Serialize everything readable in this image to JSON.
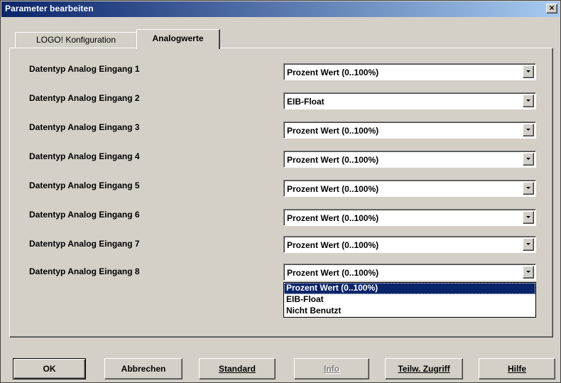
{
  "window": {
    "title": "Parameter bearbeiten",
    "close_glyph": "×"
  },
  "tabs": [
    {
      "label": "LOGO! Konfiguration",
      "active": false
    },
    {
      "label": "Analogwerte",
      "active": true
    }
  ],
  "rows": [
    {
      "label": "Datentyp Analog Eingang 1",
      "value": "Prozent Wert (0..100%)"
    },
    {
      "label": "Datentyp Analog Eingang 2",
      "value": "EIB-Float"
    },
    {
      "label": "Datentyp Analog Eingang 3",
      "value": "Prozent Wert (0..100%)"
    },
    {
      "label": "Datentyp Analog Eingang 4",
      "value": "Prozent Wert (0..100%)"
    },
    {
      "label": "Datentyp Analog Eingang 5",
      "value": "Prozent Wert (0..100%)"
    },
    {
      "label": "Datentyp Analog Eingang 6",
      "value": "Prozent Wert (0..100%)"
    },
    {
      "label": "Datentyp Analog Eingang 7",
      "value": "Prozent Wert (0..100%)"
    },
    {
      "label": "Datentyp Analog Eingang 8",
      "value": "Prozent Wert (0..100%)"
    }
  ],
  "dropdown": {
    "options": [
      "Prozent Wert (0..100%)",
      "EIB-Float",
      "Nicht Benutzt"
    ],
    "selected_index": 0
  },
  "buttons": [
    {
      "label": "OK",
      "enabled": true
    },
    {
      "label": "Abbrechen",
      "enabled": true
    },
    {
      "label": "Standard",
      "enabled": true
    },
    {
      "label": "Info",
      "enabled": false
    },
    {
      "label": "Teilw. Zugriff",
      "enabled": true
    },
    {
      "label": "Hilfe",
      "enabled": true
    }
  ],
  "colors": {
    "titlebar_start": "#0a246a",
    "titlebar_end": "#a6caf0",
    "face": "#d4d0c8",
    "highlight": "#0a246a"
  }
}
